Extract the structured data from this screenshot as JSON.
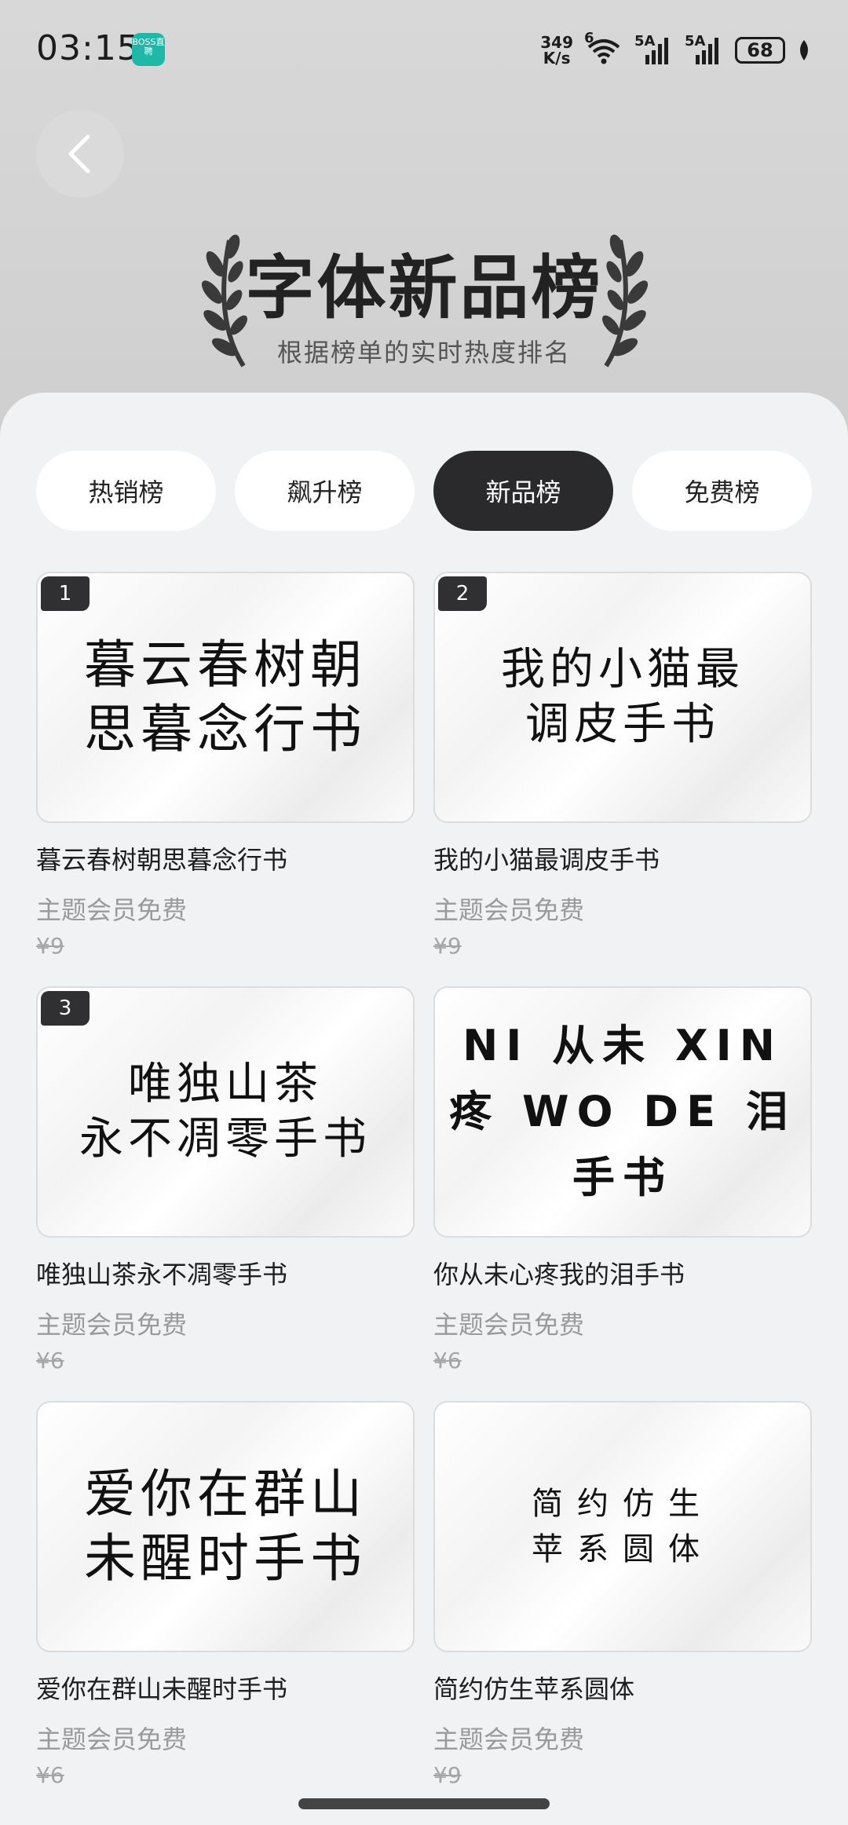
{
  "status": {
    "time": "03:15",
    "app_badge": "BOSS直聘",
    "net_speed_value": "349",
    "net_speed_unit": "K/s",
    "wifi_label": "6",
    "sim1_label": "5A",
    "sim2_label": "5A",
    "battery": "68"
  },
  "header": {
    "title": "字体新品榜",
    "subtitle": "根据榜单的实时热度排名"
  },
  "tabs": [
    {
      "label": "热销榜",
      "active": false
    },
    {
      "label": "飙升榜",
      "active": false
    },
    {
      "label": "新品榜",
      "active": true
    },
    {
      "label": "免费榜",
      "active": false
    }
  ],
  "fonts": [
    {
      "rank": "1",
      "preview_line1": "暮云春树朝",
      "preview_line2": "思暮念行书",
      "name": "暮云春树朝思暮念行书",
      "tag": "主题会员免费",
      "price": "¥9"
    },
    {
      "rank": "2",
      "preview_line1": "我的小猫最",
      "preview_line2": "调皮手书",
      "name": "我的小猫最调皮手书",
      "tag": "主题会员免费",
      "price": "¥9"
    },
    {
      "rank": "3",
      "preview_line1": "唯独山茶",
      "preview_line2": "永不凋零手书",
      "name": "唯独山茶永不凋零手书",
      "tag": "主题会员免费",
      "price": "¥6"
    },
    {
      "rank": "",
      "preview_line1": "NI 从未 XIN",
      "preview_line2": "疼 WO DE 泪",
      "preview_line3": "手书",
      "name": "你从未心疼我的泪手书",
      "tag": "主题会员免费",
      "price": "¥6"
    },
    {
      "rank": "",
      "preview_line1": "爱你在群山",
      "preview_line2": "未醒时手书",
      "name": "爱你在群山未醒时手书",
      "tag": "主题会员免费",
      "price": "¥6"
    },
    {
      "rank": "",
      "preview_line1": "简约仿生",
      "preview_line2": "苹系圆体",
      "name": "简约仿生苹系圆体",
      "tag": "主题会员免费",
      "price": "¥9"
    }
  ]
}
